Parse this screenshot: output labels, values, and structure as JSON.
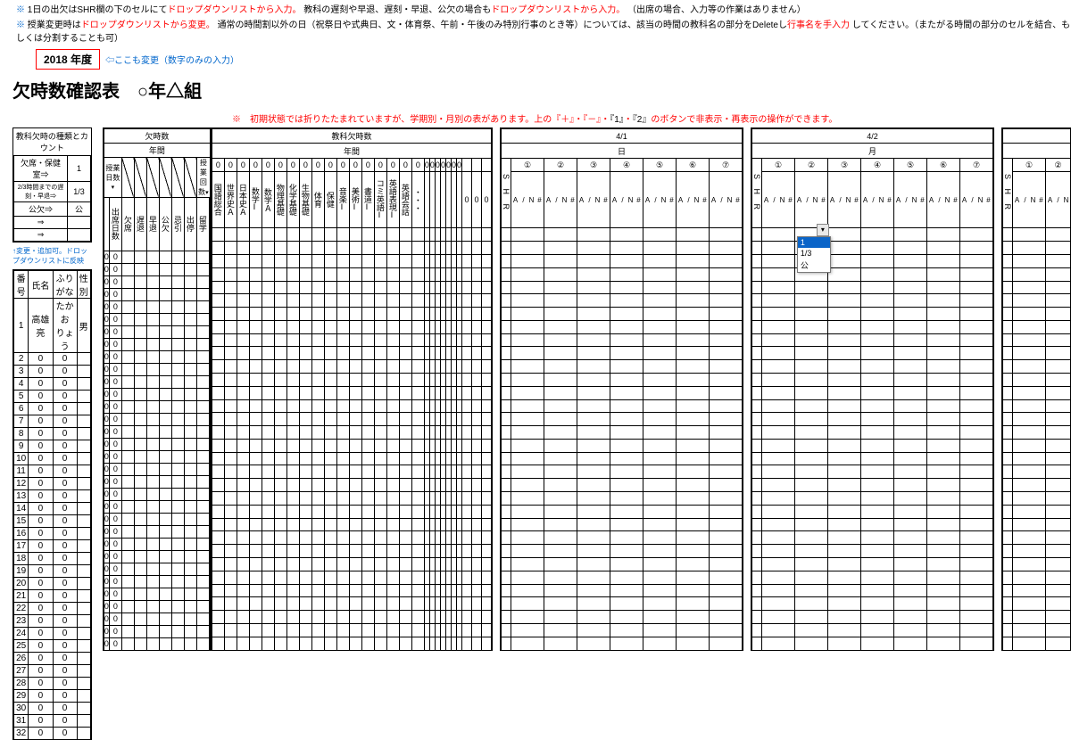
{
  "notes": {
    "n1_mark": "※",
    "n1_a": "1日の出欠はSHR欄の下のセルにて",
    "n1_b": "ドロップダウンリストから入力。",
    "n1_c": "教科の遅刻や早退、遅刻・早退、公欠の場合も",
    "n1_d": "ドロップダウンリストから入力。",
    "n1_e": "（出席の場合、入力等の作業はありません）",
    "n2_mark": "※",
    "n2_a": "授業変更時は",
    "n2_b": "ドロップダウンリストから変更。",
    "n2_c": "通常の時間割以外の日（祝祭日や式典日、文・体育祭、午前・午後のみ特別行事のとき等）については、該当の時間の教科名の部分をDeleteし",
    "n2_d": "行事名を手入力",
    "n2_e": "してください。（またがる時間の部分のセルを結合、もしくは分割することも可）"
  },
  "year": {
    "value": "2018 年度",
    "hint": "⇦ここも変更（数字のみの入力）"
  },
  "title": "欠時数確認表　○年△組",
  "red_note_a": "※　初期状態では折りたたまれていますが、学期別・月別の表があります。上の『＋』・『－』・",
  "red_note_b": "『1』",
  "red_note_c": "・",
  "red_note_d": "『2』",
  "red_note_e": "のボタンで非表示・再表示の操作ができます。",
  "info": {
    "title": "教科欠時の種類とカウント",
    "r1a": "欠席・保健室⇒",
    "r1b": "1",
    "r2a": "2/3時間までの遅刻・早退⇒",
    "r2b": "1/3",
    "r3a": "公欠⇒",
    "r3b": "公",
    "r4a": "⇒",
    "r4b": "",
    "r5a": "⇒",
    "r5b": ""
  },
  "info_note": "↑変更・追加可。ドロップダウンリストに反映",
  "roster_hdr": {
    "num": "番号",
    "name": "氏名",
    "kana": "ふりがな",
    "sex": "性別"
  },
  "roster_first": {
    "num": "1",
    "name": "高雄　亮",
    "kana": "たかお　りょう",
    "sex": "男"
  },
  "roster_rows": 32,
  "zero": "0",
  "block1": {
    "top": "欠時数",
    "mid": "年間",
    "lab1": "授業日数",
    "lab2": "授業回数",
    "cols": [
      "出席日数",
      "欠席",
      "遅退",
      "早退",
      "公欠",
      "忌引",
      "出停",
      "留学"
    ]
  },
  "block2": {
    "top": "教科欠時数",
    "mid": "年間",
    "zeros": 24,
    "cols": [
      "国語総合",
      "世界史Ａ",
      "日本史Ａ",
      "数学Ⅰ",
      "数学Ａ",
      "物理基礎",
      "化学基礎",
      "生物基礎",
      "体育",
      "保健",
      "音楽Ⅰ",
      "美術Ⅰ",
      "書道Ⅰ",
      "コミ英語Ⅰ",
      "英語表現Ⅰ",
      "英語会話",
      "・・・",
      "",
      "",
      "",
      "",
      "",
      "",
      ""
    ],
    "tail": [
      "0",
      "0",
      "0"
    ]
  },
  "day1": {
    "date": "4/1",
    "dow": "日"
  },
  "day2": {
    "date": "4/2",
    "dow": "月"
  },
  "shr": "S H R",
  "circled": [
    "①",
    "②",
    "③",
    "④",
    "⑤",
    "⑥",
    "⑦"
  ],
  "subhead": {
    "h": "#",
    "n": "N",
    "s": "/",
    "a": "A"
  },
  "dropdown": {
    "sel": "1",
    "o1": "1/3",
    "o2": "公"
  }
}
